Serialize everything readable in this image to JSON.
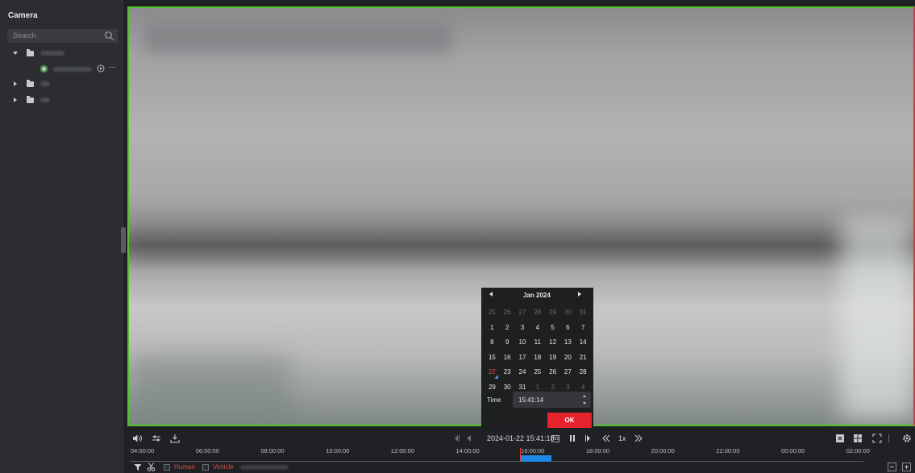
{
  "sidebar": {
    "title": "Camera",
    "search_placeholder": "Search"
  },
  "toolbar": {
    "datetime": "2024-01-22 15:41:18",
    "speed": "1x"
  },
  "calendar": {
    "month_label": "Jan  2024",
    "weeks": [
      [
        {
          "d": "25",
          "m": true
        },
        {
          "d": "26",
          "m": true
        },
        {
          "d": "27",
          "m": true
        },
        {
          "d": "28",
          "m": true
        },
        {
          "d": "29",
          "m": true
        },
        {
          "d": "30",
          "m": true
        },
        {
          "d": "31",
          "m": true
        }
      ],
      [
        {
          "d": "1"
        },
        {
          "d": "2"
        },
        {
          "d": "3"
        },
        {
          "d": "4"
        },
        {
          "d": "5"
        },
        {
          "d": "6"
        },
        {
          "d": "7"
        }
      ],
      [
        {
          "d": "8"
        },
        {
          "d": "9"
        },
        {
          "d": "10"
        },
        {
          "d": "11"
        },
        {
          "d": "12"
        },
        {
          "d": "13"
        },
        {
          "d": "14"
        }
      ],
      [
        {
          "d": "15"
        },
        {
          "d": "16"
        },
        {
          "d": "17"
        },
        {
          "d": "18"
        },
        {
          "d": "19"
        },
        {
          "d": "20"
        },
        {
          "d": "21"
        }
      ],
      [
        {
          "d": "22",
          "today": true
        },
        {
          "d": "23"
        },
        {
          "d": "24"
        },
        {
          "d": "25"
        },
        {
          "d": "26"
        },
        {
          "d": "27"
        },
        {
          "d": "28"
        }
      ],
      [
        {
          "d": "29"
        },
        {
          "d": "30"
        },
        {
          "d": "31"
        },
        {
          "d": "1",
          "m": true
        },
        {
          "d": "2",
          "m": true
        },
        {
          "d": "3",
          "m": true
        },
        {
          "d": "4",
          "m": true
        }
      ]
    ],
    "time_label": "Time",
    "time_value": "15:41:14",
    "ok_label": "OK"
  },
  "timeline": {
    "labels": [
      "04:00:00",
      "06:00:00",
      "08:00:00",
      "10:00:00",
      "12:00:00",
      "14:00:00",
      "16:00:00",
      "18:00:00",
      "20:00:00",
      "22:00:00",
      "00:00:00",
      "02:00:00"
    ]
  },
  "filters": {
    "human_label": "Human",
    "vehicle_label": "Vehicle"
  },
  "colors": {
    "accent_red": "#e5232d",
    "recording_blue": "#1e88e5",
    "active_border": "#4fc52b"
  }
}
